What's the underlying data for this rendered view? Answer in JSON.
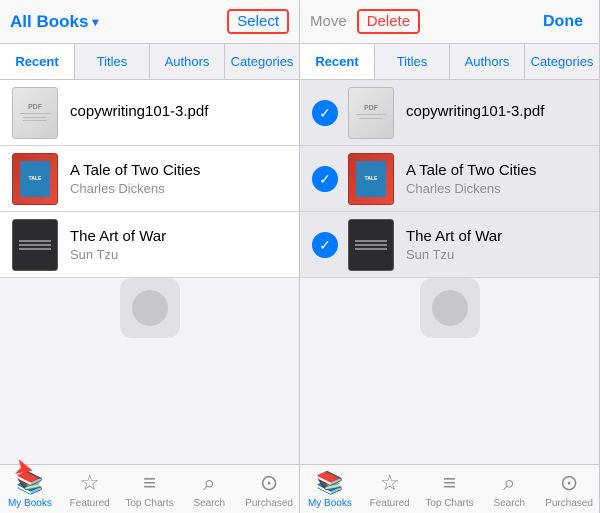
{
  "left_panel": {
    "header": {
      "title": "All Books",
      "title_suffix": "▾",
      "select_label": "Select"
    },
    "tabs": [
      {
        "label": "Recent",
        "active": true
      },
      {
        "label": "Titles",
        "active": false
      },
      {
        "label": "Authors",
        "active": false
      },
      {
        "label": "Categories",
        "active": false
      }
    ],
    "books": [
      {
        "title": "copywriting101-3.pdf",
        "author": "",
        "cover_type": "pdf"
      },
      {
        "title": "A Tale of Two Cities",
        "author": "Charles Dickens",
        "cover_type": "tale"
      },
      {
        "title": "The Art of War",
        "author": "Sun Tzu",
        "cover_type": "war"
      }
    ],
    "tab_bar": {
      "items": [
        {
          "label": "My Books",
          "active": true,
          "icon": "📚"
        },
        {
          "label": "Featured",
          "active": false,
          "icon": "☆"
        },
        {
          "label": "Top Charts",
          "active": false,
          "icon": "≡"
        },
        {
          "label": "Search",
          "active": false,
          "icon": "⌕"
        },
        {
          "label": "Purchased",
          "active": false,
          "icon": "⊙"
        }
      ]
    }
  },
  "right_panel": {
    "header": {
      "move_label": "Move",
      "delete_label": "Delete",
      "done_label": "Done"
    },
    "tabs": [
      {
        "label": "Recent",
        "active": true
      },
      {
        "label": "Titles",
        "active": false
      },
      {
        "label": "Authors",
        "active": false
      },
      {
        "label": "Categories",
        "active": false
      }
    ],
    "books": [
      {
        "title": "copywriting101-3.pdf",
        "author": "",
        "cover_type": "pdf",
        "selected": true
      },
      {
        "title": "A Tale of Two Cities",
        "author": "Charles Dickens",
        "cover_type": "tale",
        "selected": true
      },
      {
        "title": "The Art of War",
        "author": "Sun Tzu",
        "cover_type": "war",
        "selected": true
      }
    ],
    "tab_bar": {
      "items": [
        {
          "label": "My Books",
          "active": true,
          "icon": "📚"
        },
        {
          "label": "Featured",
          "active": false,
          "icon": "☆"
        },
        {
          "label": "Top Charts",
          "active": false,
          "icon": "≡"
        },
        {
          "label": "Search",
          "active": false,
          "icon": "⌕"
        },
        {
          "label": "Purchased",
          "active": false,
          "icon": "⊙"
        }
      ]
    }
  }
}
